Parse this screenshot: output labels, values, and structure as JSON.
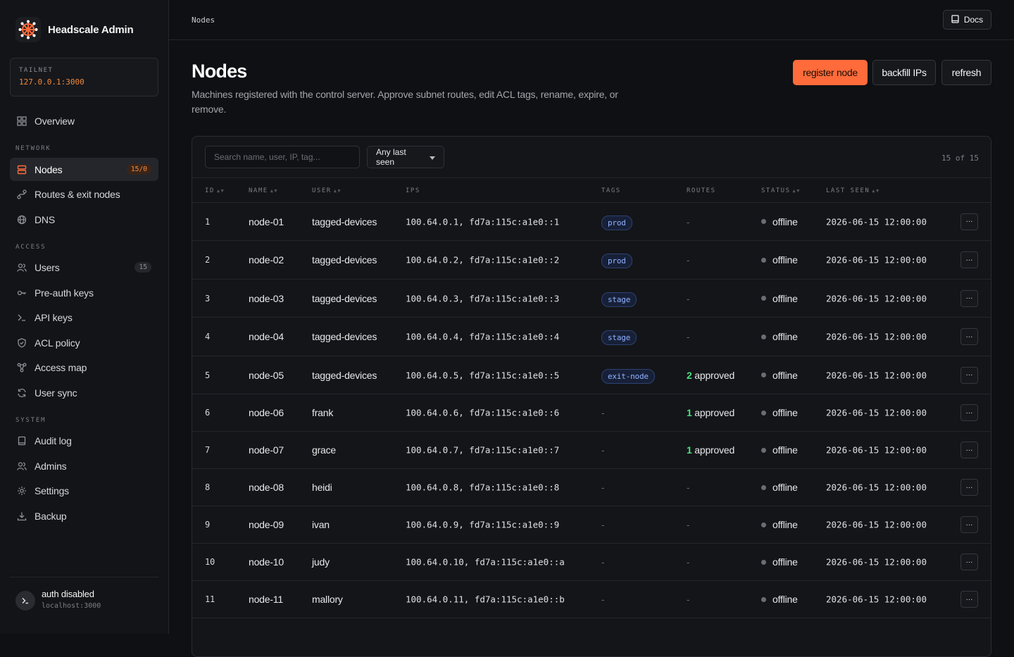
{
  "brand": {
    "name": "Headscale Admin"
  },
  "tailnet": {
    "label": "TAILNET",
    "value": "127.0.0.1:3000"
  },
  "sidebar": {
    "overview": "Overview",
    "sections": {
      "network": "NETWORK",
      "access": "ACCESS",
      "system": "SYSTEM"
    },
    "network": [
      {
        "label": "Nodes",
        "badge": "15/0",
        "active": true,
        "icon": "server-icon"
      },
      {
        "label": "Routes & exit nodes",
        "icon": "route-icon"
      },
      {
        "label": "DNS",
        "icon": "globe-icon"
      }
    ],
    "access": [
      {
        "label": "Users",
        "badge": "15",
        "icon": "users-icon"
      },
      {
        "label": "Pre-auth keys",
        "icon": "key-icon"
      },
      {
        "label": "API keys",
        "icon": "terminal-icon"
      },
      {
        "label": "ACL policy",
        "icon": "shield-icon"
      },
      {
        "label": "Access map",
        "icon": "graph-icon"
      },
      {
        "label": "User sync",
        "icon": "sync-icon"
      }
    ],
    "system": [
      {
        "label": "Audit log",
        "icon": "book-icon"
      },
      {
        "label": "Admins",
        "icon": "admins-icon"
      },
      {
        "label": "Settings",
        "icon": "gear-icon"
      },
      {
        "label": "Backup",
        "icon": "download-icon"
      }
    ],
    "footer": {
      "title": "auth disabled",
      "subtitle": "localhost:3000"
    }
  },
  "topbar": {
    "breadcrumb": "Nodes",
    "docs_label": "Docs"
  },
  "header": {
    "title": "Nodes",
    "description": "Machines registered with the control server. Approve subnet routes, edit ACL tags, rename, expire, or remove.",
    "actions": {
      "register": "register node",
      "backfill": "backfill IPs",
      "refresh": "refresh"
    }
  },
  "filters": {
    "search_placeholder": "Search name, user, IP, tag...",
    "last_seen": "Any last seen",
    "count": "15 of 15"
  },
  "table": {
    "columns": {
      "id": "ID",
      "name": "NAME",
      "user": "USER",
      "ips": "IPS",
      "tags": "TAGS",
      "routes": "ROUTES",
      "status": "STATUS",
      "last_seen": "LAST SEEN"
    },
    "rows": [
      {
        "id": "1",
        "name": "node-01",
        "user": "tagged-devices",
        "ips": "100.64.0.1, fd7a:115c:a1e0::1",
        "tag": "prod",
        "routes_count": "",
        "routes_text": "-",
        "status": "offline",
        "last_seen": "2026-06-15 12:00:00"
      },
      {
        "id": "2",
        "name": "node-02",
        "user": "tagged-devices",
        "ips": "100.64.0.2, fd7a:115c:a1e0::2",
        "tag": "prod",
        "routes_count": "",
        "routes_text": "-",
        "status": "offline",
        "last_seen": "2026-06-15 12:00:00"
      },
      {
        "id": "3",
        "name": "node-03",
        "user": "tagged-devices",
        "ips": "100.64.0.3, fd7a:115c:a1e0::3",
        "tag": "stage",
        "routes_count": "",
        "routes_text": "-",
        "status": "offline",
        "last_seen": "2026-06-15 12:00:00"
      },
      {
        "id": "4",
        "name": "node-04",
        "user": "tagged-devices",
        "ips": "100.64.0.4, fd7a:115c:a1e0::4",
        "tag": "stage",
        "routes_count": "",
        "routes_text": "-",
        "status": "offline",
        "last_seen": "2026-06-15 12:00:00"
      },
      {
        "id": "5",
        "name": "node-05",
        "user": "tagged-devices",
        "ips": "100.64.0.5, fd7a:115c:a1e0::5",
        "tag": "exit-node",
        "routes_count": "2",
        "routes_text": " approved",
        "status": "offline",
        "last_seen": "2026-06-15 12:00:00"
      },
      {
        "id": "6",
        "name": "node-06",
        "user": "frank",
        "ips": "100.64.0.6, fd7a:115c:a1e0::6",
        "tag": "",
        "routes_count": "1",
        "routes_text": " approved",
        "status": "offline",
        "last_seen": "2026-06-15 12:00:00"
      },
      {
        "id": "7",
        "name": "node-07",
        "user": "grace",
        "ips": "100.64.0.7, fd7a:115c:a1e0::7",
        "tag": "",
        "routes_count": "1",
        "routes_text": " approved",
        "status": "offline",
        "last_seen": "2026-06-15 12:00:00"
      },
      {
        "id": "8",
        "name": "node-08",
        "user": "heidi",
        "ips": "100.64.0.8, fd7a:115c:a1e0::8",
        "tag": "",
        "routes_count": "",
        "routes_text": "-",
        "status": "offline",
        "last_seen": "2026-06-15 12:00:00"
      },
      {
        "id": "9",
        "name": "node-09",
        "user": "ivan",
        "ips": "100.64.0.9, fd7a:115c:a1e0::9",
        "tag": "",
        "routes_count": "",
        "routes_text": "-",
        "status": "offline",
        "last_seen": "2026-06-15 12:00:00"
      },
      {
        "id": "10",
        "name": "node-10",
        "user": "judy",
        "ips": "100.64.0.10, fd7a:115c:a1e0::a",
        "tag": "",
        "routes_count": "",
        "routes_text": "-",
        "status": "offline",
        "last_seen": "2026-06-15 12:00:00"
      },
      {
        "id": "11",
        "name": "node-11",
        "user": "mallory",
        "ips": "100.64.0.11, fd7a:115c:a1e0::b",
        "tag": "",
        "routes_count": "",
        "routes_text": "-",
        "status": "offline",
        "last_seen": "2026-06-15 12:00:00"
      }
    ],
    "more_label": "···"
  },
  "colors": {
    "accent": "#ff6b3a",
    "approved": "#4ade80",
    "tag": "#8fb2ff"
  }
}
